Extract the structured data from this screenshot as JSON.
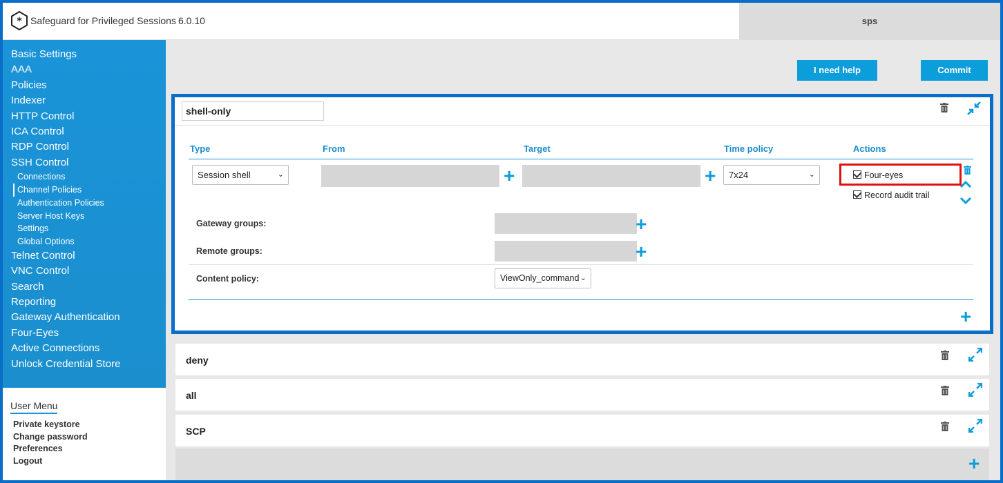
{
  "header": {
    "app_title": "Safeguard for Privileged Sessions",
    "version": "6.0.10",
    "hostname": "sps"
  },
  "sidebar": {
    "items": [
      {
        "label": "Basic Settings"
      },
      {
        "label": "AAA"
      },
      {
        "label": "Policies"
      },
      {
        "label": "Indexer"
      },
      {
        "label": "HTTP Control"
      },
      {
        "label": "ICA Control"
      },
      {
        "label": "RDP Control"
      },
      {
        "label": "SSH Control"
      }
    ],
    "ssh_subitems": [
      {
        "label": "Connections"
      },
      {
        "label": "Channel Policies",
        "active": true
      },
      {
        "label": "Authentication Policies"
      },
      {
        "label": "Server Host Keys"
      },
      {
        "label": "Settings"
      },
      {
        "label": "Global Options"
      }
    ],
    "items_after": [
      {
        "label": "Telnet Control"
      },
      {
        "label": "VNC Control"
      },
      {
        "label": "Search"
      },
      {
        "label": "Reporting"
      },
      {
        "label": "Gateway Authentication"
      },
      {
        "label": "Four-Eyes"
      },
      {
        "label": "Active Connections"
      },
      {
        "label": "Unlock Credential Store"
      }
    ]
  },
  "user_menu": {
    "title": "User Menu",
    "items": [
      "Private keystore",
      "Change password",
      "Preferences",
      "Logout"
    ]
  },
  "toolbar": {
    "help_label": "I need help",
    "commit_label": "Commit"
  },
  "policy": {
    "name": "shell-only",
    "columns": {
      "type": "Type",
      "from": "From",
      "target": "Target",
      "time_policy": "Time policy",
      "actions": "Actions"
    },
    "rule": {
      "type_value": "Session shell",
      "time_policy_value": "7x24",
      "four_eyes_label": "Four-eyes",
      "four_eyes_checked": true,
      "audit_label": "Record audit trail",
      "audit_checked": true
    },
    "gateway_groups_label": "Gateway groups:",
    "remote_groups_label": "Remote groups:",
    "content_policy_label": "Content policy:",
    "content_policy_value": "ViewOnly_commands"
  },
  "other_policies": [
    {
      "name": "deny"
    },
    {
      "name": "all"
    },
    {
      "name": "SCP"
    }
  ],
  "colors": {
    "accent": "#0c9ddb",
    "sidebar": "#1a93d8",
    "frame": "#0a6ec8",
    "highlight": "#e01010"
  }
}
